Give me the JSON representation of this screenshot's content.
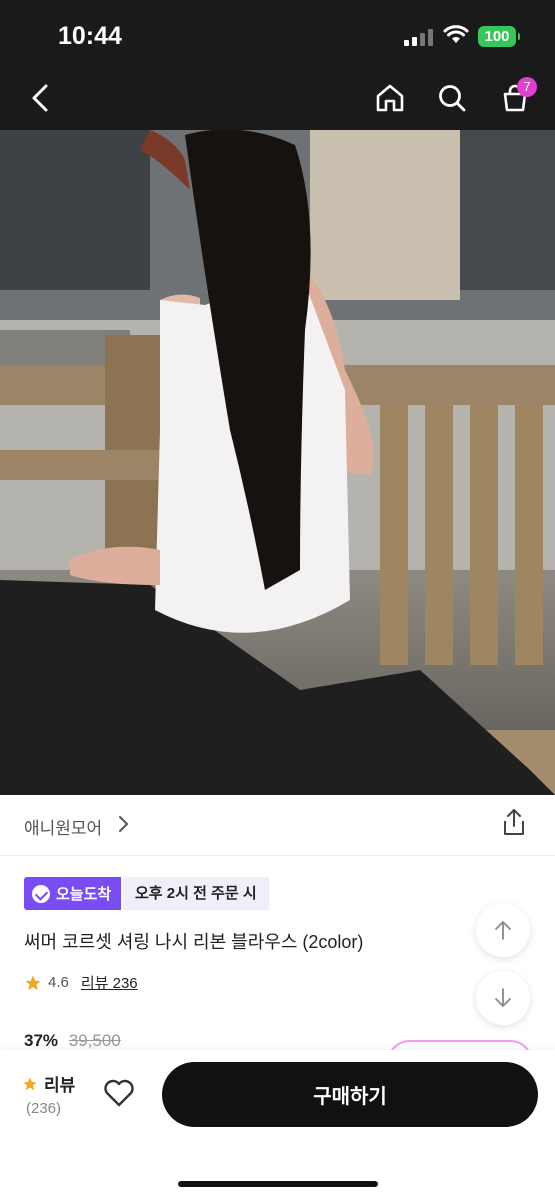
{
  "status_bar": {
    "time": "10:44",
    "battery": "100"
  },
  "header": {
    "cart_count": "7"
  },
  "store": {
    "name": "애니원모어"
  },
  "product": {
    "delivery_badge": "오늘도착",
    "delivery_time": "오후 2시 전 주문 시",
    "title": "써머 코르셋 셔링 나시 리본 블라우스 (2color)",
    "rating": "4.6",
    "review_link": "리뷰 236",
    "discount": "37%",
    "original_price": "39,500"
  },
  "bottom_bar": {
    "review_label": "리뷰",
    "review_count": "(236)",
    "buy_label": "구매하기"
  },
  "colors": {
    "accent": "#7a4cf4",
    "badge_pink": "#e13fd0",
    "star": "#f5a623",
    "buy_button": "#111111"
  },
  "icons": [
    "back-icon",
    "home-icon",
    "search-icon",
    "cart-icon",
    "chevron-right-icon",
    "share-icon",
    "clock-check-icon",
    "star-icon",
    "arrow-up-icon",
    "arrow-down-icon",
    "heart-icon"
  ]
}
